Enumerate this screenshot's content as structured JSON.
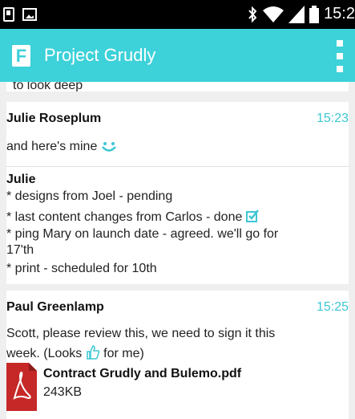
{
  "status_bar": {
    "time": "15:2"
  },
  "app_bar": {
    "logo_letter": "F",
    "title": "Project Grudly"
  },
  "messages": {
    "cut_off_text": "to look deep",
    "julie_roseplum": {
      "sender": "Julie Roseplum",
      "time": "15:23",
      "text": "and here's mine"
    },
    "julie": {
      "sender": "Julie",
      "lines": [
        "* designs from Joel - pending",
        "* last content changes from Carlos - done",
        "* ping Mary on launch date - agreed. we'll go for",
        "17'th",
        "* print - scheduled for 10th"
      ]
    },
    "paul": {
      "sender": "Paul Greenlamp",
      "time": "15:25",
      "line1": "Scott, please review this, we need to sign it this",
      "line2_before": "week. (Looks",
      "line2_after": "for me)"
    }
  },
  "attachment": {
    "name": "Contract Grudly and Bulemo.pdf",
    "size": "243KB"
  },
  "colors": {
    "accent": "#3dd1d9",
    "time_text": "#3dc6d3",
    "pdf_red": "#c62828"
  },
  "icons": [
    "notification-icon",
    "gallery-icon",
    "bluetooth-icon",
    "wifi-icon",
    "signal-icon",
    "battery-icon",
    "smile-icon",
    "check-icon",
    "thumbs-up-icon",
    "pdf-icon",
    "overflow-menu-icon"
  ]
}
